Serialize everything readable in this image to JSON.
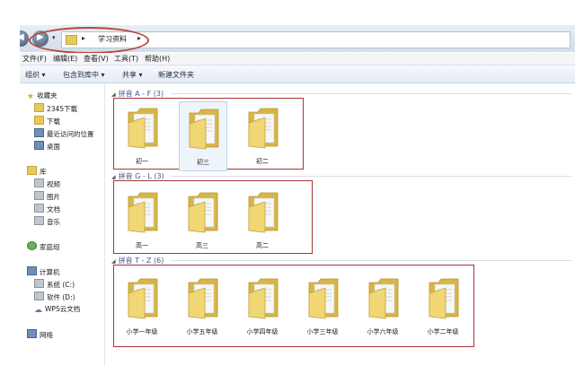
{
  "address": {
    "path": [
      "学习资料"
    ],
    "nav_back_label": "◀",
    "nav_forward_label": "▶",
    "nav_dropdown": "▾",
    "separator": "▸"
  },
  "menubar": [
    "文件(F)",
    "编辑(E)",
    "查看(V)",
    "工具(T)",
    "帮助(H)"
  ],
  "toolbar": {
    "organize": "组织 ▾",
    "include_in_library": "包含到库中 ▾",
    "share": "共享 ▾",
    "new_folder": "新建文件夹"
  },
  "nav": {
    "favorites": "收藏夹",
    "favorites_items": [
      "2345下载",
      "下载",
      "最近访问的位置",
      "桌面"
    ],
    "libraries": "库",
    "libraries_items": [
      "视频",
      "图片",
      "文档",
      "音乐"
    ],
    "homegroup": "家庭组",
    "computer": "计算机",
    "computer_items": [
      "系统 (C:)",
      "软件 (D:)",
      "WPS云文档"
    ],
    "network": "网络"
  },
  "groups": [
    {
      "header": "拼音 A - F (3)",
      "folders": [
        "初一",
        "初三",
        "初二"
      ]
    },
    {
      "header": "拼音 G - L (3)",
      "folders": [
        "高一",
        "高三",
        "高二"
      ]
    },
    {
      "header": "拼音 T - Z (6)",
      "folders": [
        "小学一年级",
        "小学五年级",
        "小学四年级",
        "小学三年级",
        "小学六年级",
        "小学二年级"
      ]
    }
  ],
  "colors": {
    "annotation_red": "#a9343a",
    "folder_yellow": "#e7c95d",
    "group_header_blue": "#3a5f8e"
  }
}
